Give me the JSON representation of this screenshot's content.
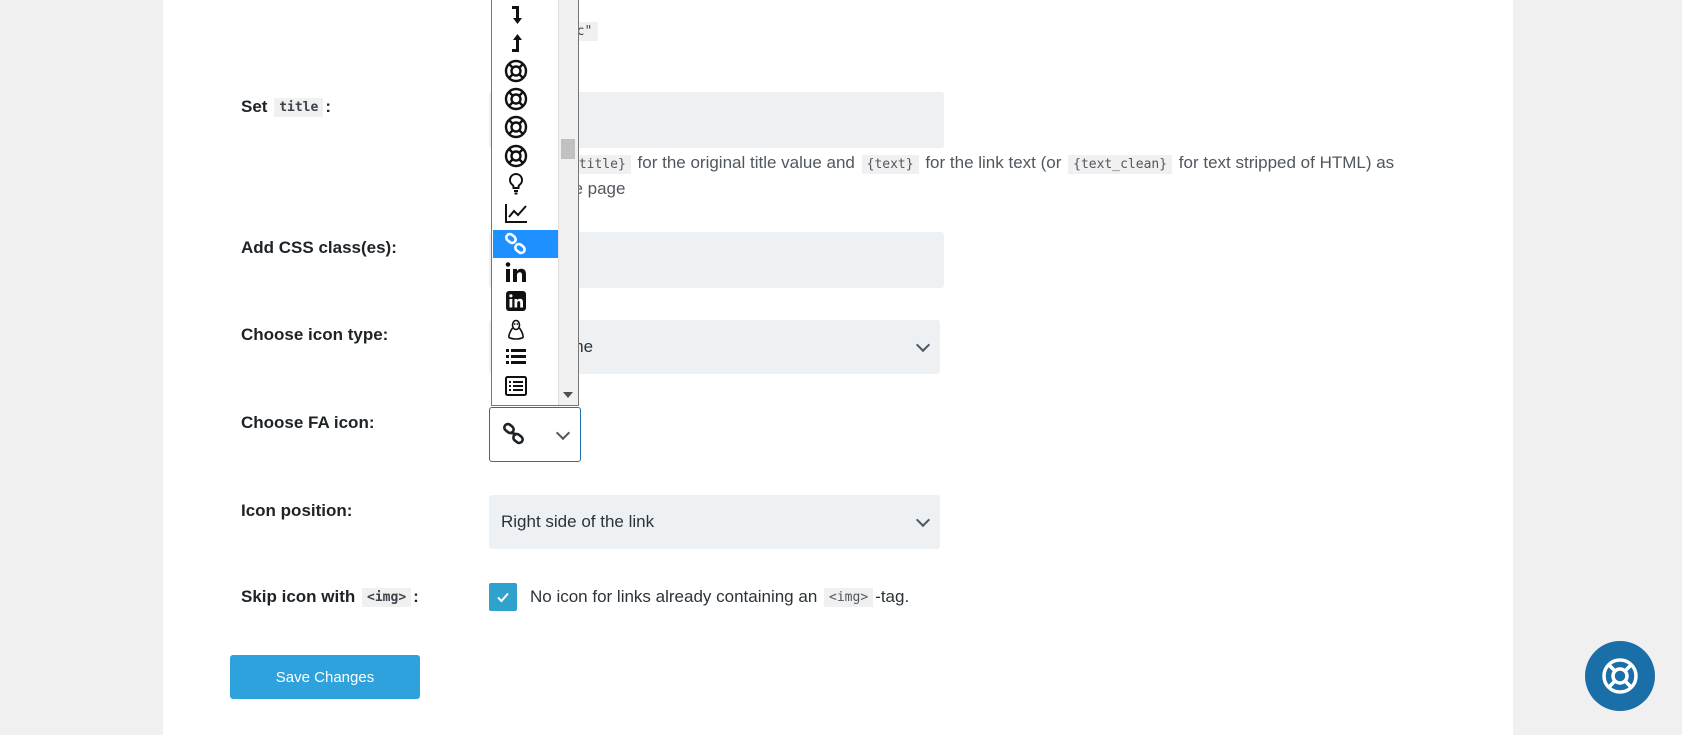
{
  "form": {
    "rel_snippet": "ugc\"",
    "title_label_prefix": "Set",
    "title_label_code": "title",
    "title_label_suffix": ":",
    "title_value": "",
    "title_desc_code1": "{title}",
    "title_desc_part1": "for the original title value and",
    "title_desc_code2": "{text}",
    "title_desc_part2": "for the link text (or",
    "title_desc_code3": "{text_clean}",
    "title_desc_part3": "for text stripped of HTML) as",
    "title_desc_line2": "he page",
    "css_label": "Add CSS class(es):",
    "css_value": "",
    "icon_type_label": "Choose icon type:",
    "icon_type_value": "ome",
    "fa_icon_label": "Choose FA icon:",
    "fa_icon_selected": "link",
    "icon_position_label": "Icon position:",
    "icon_position_value": "Right side of the link",
    "skip_label_prefix": "Skip icon with",
    "skip_label_code": "<img>",
    "skip_label_suffix": ":",
    "skip_checked": true,
    "skip_desc_prefix": "No icon for links already containing an",
    "skip_desc_code": "<img>",
    "skip_desc_suffix": "-tag.",
    "save_button": "Save Changes"
  },
  "fa_dropdown": {
    "items": [
      {
        "icon": "level-down-icon"
      },
      {
        "icon": "level-up-icon"
      },
      {
        "icon": "life-bouy-icon"
      },
      {
        "icon": "life-buoy-icon"
      },
      {
        "icon": "life-ring-icon"
      },
      {
        "icon": "life-saver-icon"
      },
      {
        "icon": "lightbulb-icon"
      },
      {
        "icon": "line-chart-icon"
      },
      {
        "icon": "link-icon",
        "selected": true
      },
      {
        "icon": "linkedin-icon"
      },
      {
        "icon": "linkedin-square-icon"
      },
      {
        "icon": "linux-icon"
      },
      {
        "icon": "list-icon"
      },
      {
        "icon": "list-alt-icon"
      }
    ]
  },
  "colors": {
    "accent": "#2ea2cc",
    "selected_option": "#1e90ff",
    "help_fab": "#1b6fa8"
  }
}
